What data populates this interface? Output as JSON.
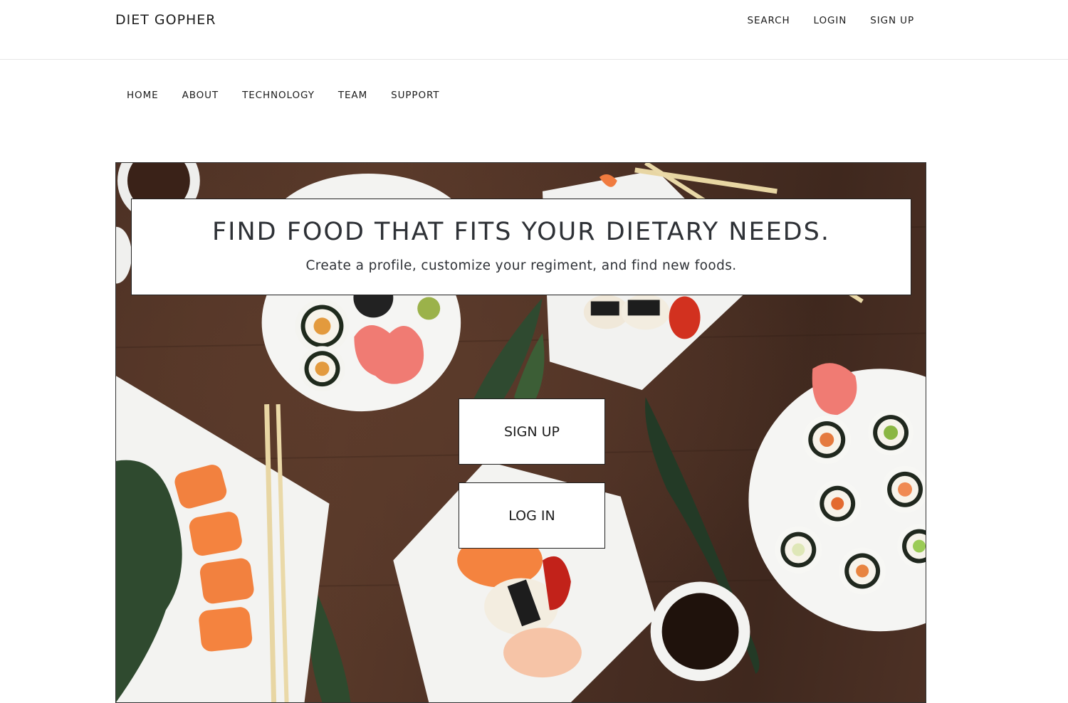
{
  "header": {
    "brand": "DIET GOPHER",
    "links": [
      "SEARCH",
      "LOGIN",
      "SIGN UP"
    ]
  },
  "nav": {
    "items": [
      "HOME",
      "ABOUT",
      "TECHNOLOGY",
      "TEAM",
      "SUPPORT"
    ]
  },
  "hero": {
    "headline": "FIND FOOD THAT FITS YOUR DIETARY NEEDS.",
    "subline": "Create a profile, customize your regiment, and find new foods.",
    "signup_label": "SIGN UP",
    "login_label": "LOG IN",
    "background_icon": "sushi-photo"
  },
  "colors": {
    "text": "#2e3136",
    "table_wood": "#4a2f23",
    "plate": "#f3f3f1",
    "salmon": "#f07b3f"
  }
}
